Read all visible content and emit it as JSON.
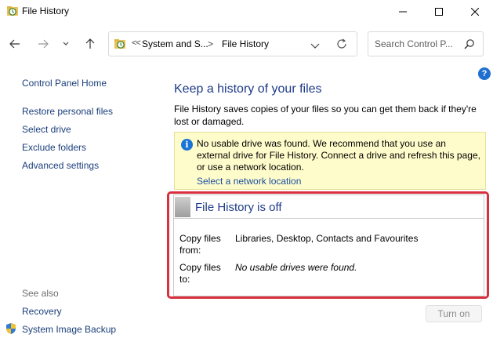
{
  "window": {
    "title": "File History",
    "minimize_icon": "minimize-icon",
    "maximize_icon": "maximize-icon",
    "close_icon": "close-icon"
  },
  "navbar": {
    "back_icon": "back-arrow-icon",
    "forward_icon": "forward-arrow-icon",
    "recent_icon": "chevron-down-icon",
    "up_icon": "up-arrow-icon",
    "breadcrumb": {
      "overflow": "<<",
      "items": [
        "System and S...",
        "File History"
      ],
      "separator": ">"
    },
    "search_placeholder": "Search Control P..."
  },
  "help": {
    "label": "?"
  },
  "sidebar": {
    "home": "Control Panel Home",
    "links": [
      "Restore personal files",
      "Select drive",
      "Exclude folders",
      "Advanced settings"
    ],
    "see_also_label": "See also",
    "see_also": [
      "Recovery",
      "System Image Backup"
    ]
  },
  "main": {
    "heading": "Keep a history of your files",
    "description": "File History saves copies of your files so you can get them back if they're lost or damaged.",
    "notice": {
      "icon_label": "i",
      "text": "No usable drive was found. We recommend that you use an external drive for File History. Connect a drive and refresh this page, or use a network location.",
      "link": "Select a network location"
    },
    "status": {
      "title": "File History is off",
      "copy_from_label": "Copy files from:",
      "copy_from_value": "Libraries, Desktop, Contacts and Favourites",
      "copy_to_label": "Copy files to:",
      "copy_to_value": "No usable drives were found."
    },
    "turn_on_label": "Turn on"
  },
  "colors": {
    "link": "#1a3e7a",
    "heading": "#1e3b8a",
    "notice_bg": "#fffccb",
    "highlight": "#d8303d"
  }
}
